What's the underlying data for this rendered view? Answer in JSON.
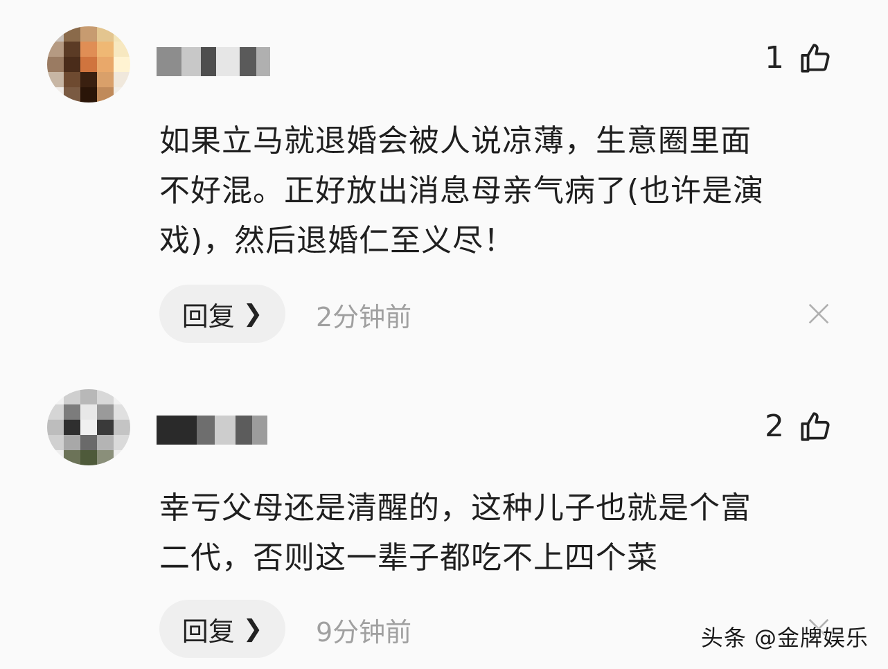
{
  "comments": [
    {
      "likes": "1",
      "text_lines": [
        "如果立马就退婚会被人说凉薄，生意圈里面",
        "不好混。正好放出消息母亲气病了(也许是演",
        "戏)，然后退婚仁至义尽！"
      ],
      "reply_label": "回复",
      "time": "2分钟前"
    },
    {
      "likes": "2",
      "text_lines": [
        "幸亏父母还是清醒的，这种儿子也就是个富",
        "二代，否则这一辈子都吃不上四个菜"
      ],
      "reply_label": "回复",
      "time": "9分钟前"
    }
  ],
  "icons": {
    "like": "thumbs-up-icon",
    "reply_chevron": "chevron-right-icon",
    "close": "close-icon"
  },
  "colors": {
    "background": "#fafafa",
    "text": "#1f1f1f",
    "muted": "#a0a0a0",
    "reply_bg": "#efefef"
  },
  "watermark": "头条 @金牌娱乐"
}
